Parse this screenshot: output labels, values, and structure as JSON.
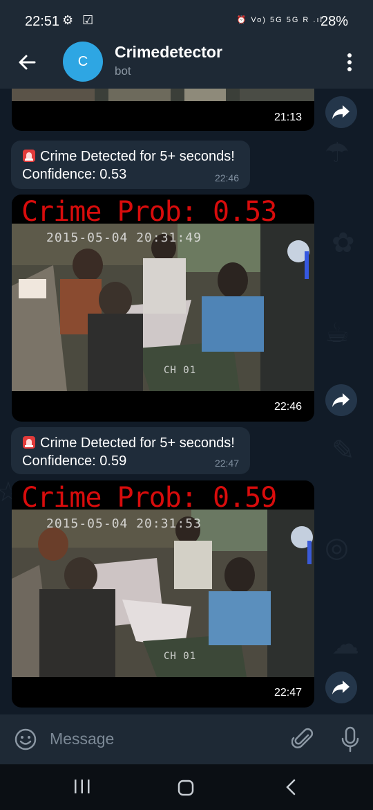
{
  "status_bar": {
    "time": "22:51",
    "left_icons": "⚙ ☑",
    "right_icons": "⏰ Vo) 5G 5G R .ıl",
    "battery": "28%"
  },
  "header": {
    "avatar_letter": "C",
    "title": "Crimedetector",
    "subtitle": "bot"
  },
  "messages": [
    {
      "type": "video",
      "time": "21:13"
    },
    {
      "type": "text",
      "line1": "Crime Detected for 5+ seconds!",
      "line2": "Confidence: 0.53",
      "time": "22:46",
      "icon": "siren-icon"
    },
    {
      "type": "video",
      "overlay": "Crime Prob: 0.53",
      "stamp": "2015-05-04 20:31:49",
      "channel": "CH 01",
      "time": "22:46"
    },
    {
      "type": "text",
      "line1": "Crime Detected for 5+ seconds!",
      "line2": "Confidence: 0.59",
      "time": "22:47",
      "icon": "siren-icon"
    },
    {
      "type": "video",
      "overlay": "Crime Prob: 0.59",
      "stamp": "2015-05-04 20:31:53",
      "channel": "CH 01",
      "time": "22:47"
    }
  ],
  "input": {
    "placeholder": "Message"
  },
  "colors": {
    "chat_bg": "#111b27",
    "bar_bg": "#1e2935",
    "bubble_bg": "#1f2c3a",
    "avatar": "#2ea6e3",
    "overlay_red": "#d80c0c"
  }
}
